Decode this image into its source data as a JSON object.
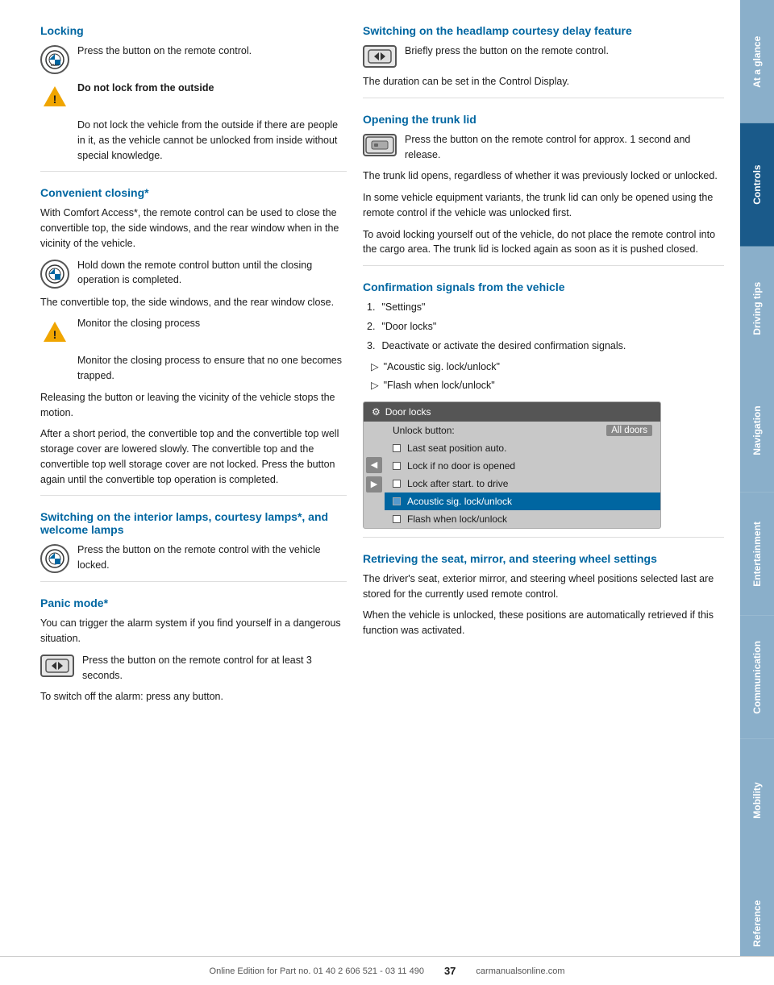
{
  "page": {
    "number": "37",
    "footer_text": "Online Edition for Part no. 01 40 2 606 521 - 03 11 490",
    "footer_brand": "carmanualsonline.com"
  },
  "sidebar": {
    "items": [
      {
        "label": "At a glance",
        "active": false
      },
      {
        "label": "Controls",
        "active": true
      },
      {
        "label": "Driving tips",
        "active": false
      },
      {
        "label": "Navigation",
        "active": false
      },
      {
        "label": "Entertainment",
        "active": false
      },
      {
        "label": "Communication",
        "active": false
      },
      {
        "label": "Mobility",
        "active": false
      },
      {
        "label": "Reference",
        "active": false
      }
    ]
  },
  "left_column": {
    "locking_heading": "Locking",
    "locking_body": "Press the button on the remote control.",
    "warning_label": "Do not lock from the outside",
    "warning_body": "Do not lock the vehicle from the outside if there are people in it, as the vehicle cannot be unlocked from inside without special knowledge.",
    "convenient_heading": "Convenient closing*",
    "convenient_body": "With Comfort Access*, the remote control can be used to close the convertible top, the side windows, and the rear window when in the vicinity of the vehicle.",
    "hold_button_text": "Hold down the remote control button until the closing operation is completed.",
    "closing_result": "The convertible top, the side windows, and the rear window close.",
    "monitor_label": "Monitor the closing process",
    "monitor_body": "Monitor the closing process to ensure that no one becomes trapped.",
    "releasing_body": "Releasing the button or leaving the vicinity of the vehicle stops the motion.",
    "after_short_body": "After a short period, the convertible top and the convertible top well storage cover are lowered slowly. The convertible top and the convertible top well storage cover are not locked. Press the button again until the convertible top operation is completed.",
    "interior_lamps_heading": "Switching on the interior lamps, courtesy lamps*, and welcome lamps",
    "interior_lamps_body": "Press the button on the remote control with the vehicle locked.",
    "panic_heading": "Panic mode*",
    "panic_body": "You can trigger the alarm system if you find yourself in a dangerous situation.",
    "panic_button_text": "Press the button on the remote control for at least 3 seconds.",
    "switch_off_alarm": "To switch off the alarm: press any button."
  },
  "right_column": {
    "headlamp_heading": "Switching on the headlamp courtesy delay feature",
    "headlamp_button_text": "Briefly press the button on the remote control.",
    "headlamp_body": "The duration can be set in the Control Display.",
    "trunk_heading": "Opening the trunk lid",
    "trunk_button_text": "Press the button on the remote control for approx. 1 second and release.",
    "trunk_body1": "The trunk lid opens, regardless of whether it was previously locked or unlocked.",
    "trunk_body2": "In some vehicle equipment variants, the trunk lid can only be opened using the remote control if the vehicle was unlocked first.",
    "trunk_body3": "To avoid locking yourself out of the vehicle, do not place the remote control into the cargo area. The trunk lid is locked again as soon as it is pushed closed.",
    "confirmation_heading": "Confirmation signals from the vehicle",
    "confirmation_steps": [
      {
        "num": "1.",
        "text": "\"Settings\""
      },
      {
        "num": "2.",
        "text": "\"Door locks\""
      },
      {
        "num": "3.",
        "text": "Deactivate or activate the desired confirmation signals."
      }
    ],
    "confirmation_bullets": [
      "\"Acoustic sig. lock/unlock\"",
      "\"Flash when lock/unlock\""
    ],
    "screen": {
      "title": "Door locks",
      "rows": [
        {
          "type": "value",
          "label": "Unlock button:",
          "value": "All doors"
        },
        {
          "type": "check",
          "label": "Last seat position auto."
        },
        {
          "type": "check",
          "label": "Lock if no door is opened"
        },
        {
          "type": "check",
          "label": "Lock after start. to drive"
        },
        {
          "type": "check",
          "label": "Acoustic sig. lock/unlock",
          "highlighted": true
        },
        {
          "type": "check",
          "label": "Flash when lock/unlock"
        }
      ]
    },
    "retrieving_heading": "Retrieving the seat, mirror, and steering wheel settings",
    "retrieving_body1": "The driver's seat, exterior mirror, and steering wheel positions selected last are stored for the currently used remote control.",
    "retrieving_body2": "When the vehicle is unlocked, these positions are automatically retrieved if this function was activated."
  }
}
